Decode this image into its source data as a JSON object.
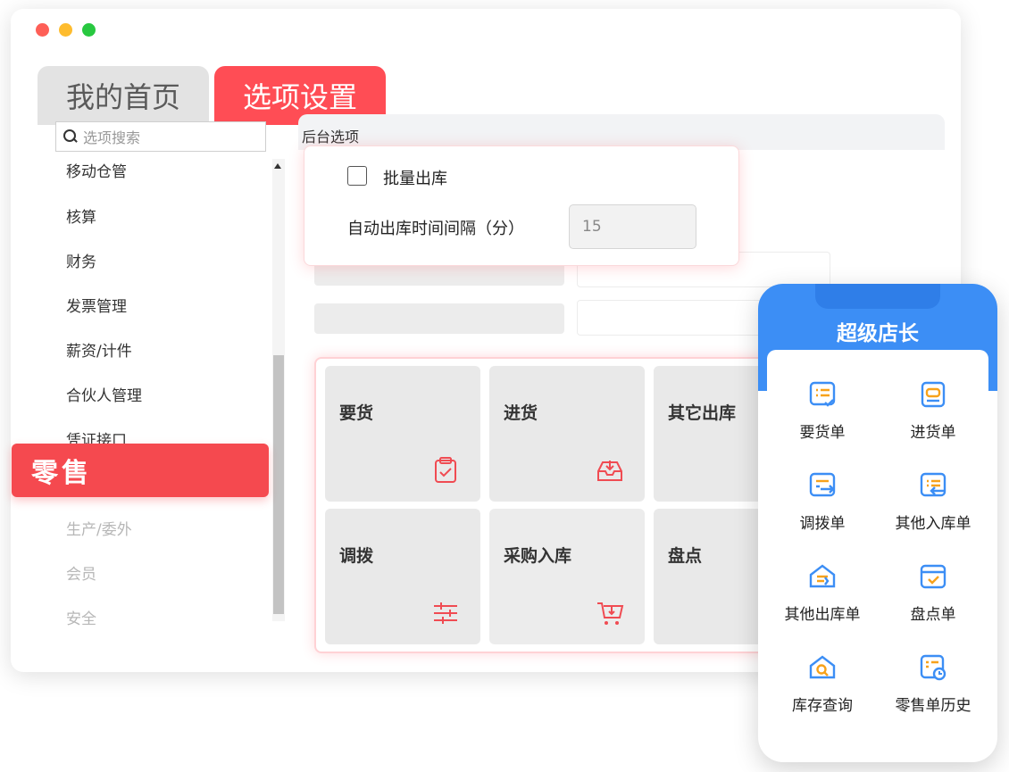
{
  "tabs": [
    {
      "label": "我的首页",
      "active": false
    },
    {
      "label": "选项设置",
      "active": true
    }
  ],
  "search": {
    "placeholder": "选项搜索"
  },
  "nav": {
    "items": [
      "移动仓管",
      "核算",
      "财务",
      "发票管理",
      "薪资/计件",
      "合伙人管理",
      "凭证接口"
    ],
    "active": "零售",
    "faded_items": [
      "生产/委外",
      "会员",
      "安全"
    ]
  },
  "settings": {
    "section_title": "后台选项",
    "batch_checkbox_label": "批量出库",
    "batch_checked": false,
    "interval_label": "自动出库时间间隔（分）",
    "interval_value": "15"
  },
  "tiles": [
    {
      "label": "要货",
      "icon": "clipboard-check-icon"
    },
    {
      "label": "进货",
      "icon": "inbox-download-icon"
    },
    {
      "label": "其它出库",
      "icon": "box-upload-icon"
    },
    {
      "label": "调拨",
      "icon": "sliders-icon"
    },
    {
      "label": "采购入库",
      "icon": "cart-icon"
    },
    {
      "label": "盘点",
      "icon": "grid-icon"
    }
  ],
  "mobile": {
    "title": "超级店长",
    "apps": [
      {
        "label": "要货单",
        "icon": "order-list-icon"
      },
      {
        "label": "进货单",
        "icon": "purchase-box-icon"
      },
      {
        "label": "调拨单",
        "icon": "transfer-icon"
      },
      {
        "label": "其他入库单",
        "icon": "stock-in-icon"
      },
      {
        "label": "其他出库单",
        "icon": "stock-out-icon"
      },
      {
        "label": "盘点单",
        "icon": "inventory-check-icon"
      },
      {
        "label": "库存查询",
        "icon": "stock-search-icon"
      },
      {
        "label": "零售单历史",
        "icon": "sales-history-icon"
      }
    ]
  },
  "colors": {
    "accent_red": "#ff4d55",
    "mobile_blue": "#3c8ef5",
    "tile_bg": "#e9e9e9",
    "icon_red": "#f04b52"
  }
}
